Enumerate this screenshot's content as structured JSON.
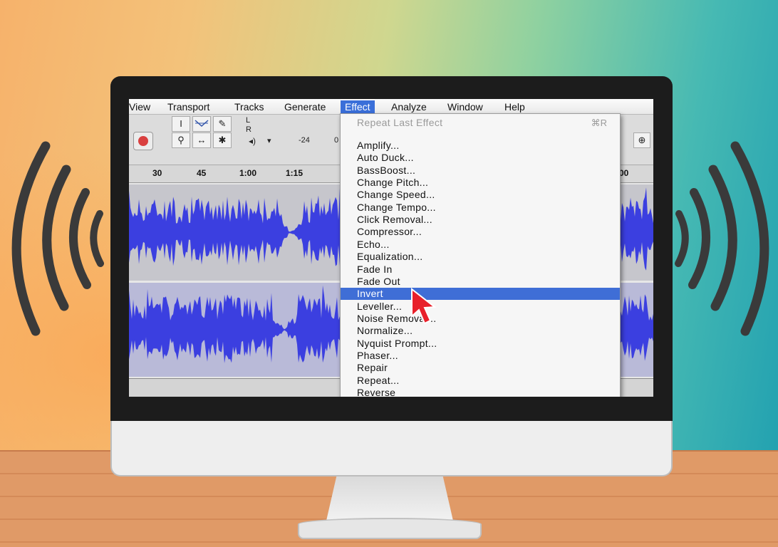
{
  "menubar": {
    "items": [
      {
        "label": "View"
      },
      {
        "label": "Transport"
      },
      {
        "label": "Tracks"
      },
      {
        "label": "Generate"
      },
      {
        "label": "Effect"
      },
      {
        "label": "Analyze"
      },
      {
        "label": "Window"
      },
      {
        "label": "Help"
      }
    ],
    "active": "Effect"
  },
  "toolbar": {
    "meter_l": "L",
    "meter_r": "R",
    "meter_db": "-24",
    "meter_zero": "0"
  },
  "timeline": {
    "ticks": [
      "30",
      "45",
      "1:00",
      "1:15",
      "00"
    ]
  },
  "effect_menu": {
    "repeat_last": {
      "label": "Repeat Last Effect",
      "shortcut": "⌘R"
    },
    "items": [
      "Amplify...",
      "Auto Duck...",
      "BassBoost...",
      "Change Pitch...",
      "Change Speed...",
      "Change Tempo...",
      "Click Removal...",
      "Compressor...",
      "Echo...",
      "Equalization...",
      "Fade In",
      "Fade Out",
      "Invert",
      "Leveller...",
      "Noise Removal...",
      "Normalize...",
      "Nyquist Prompt...",
      "Phaser...",
      "Repair",
      "Repeat...",
      "Reverse"
    ],
    "selected": "Invert"
  },
  "colors": {
    "waveform": "#3b3fe0",
    "menu_highlight": "#3f6ed6",
    "cursor": "#e8202a"
  }
}
